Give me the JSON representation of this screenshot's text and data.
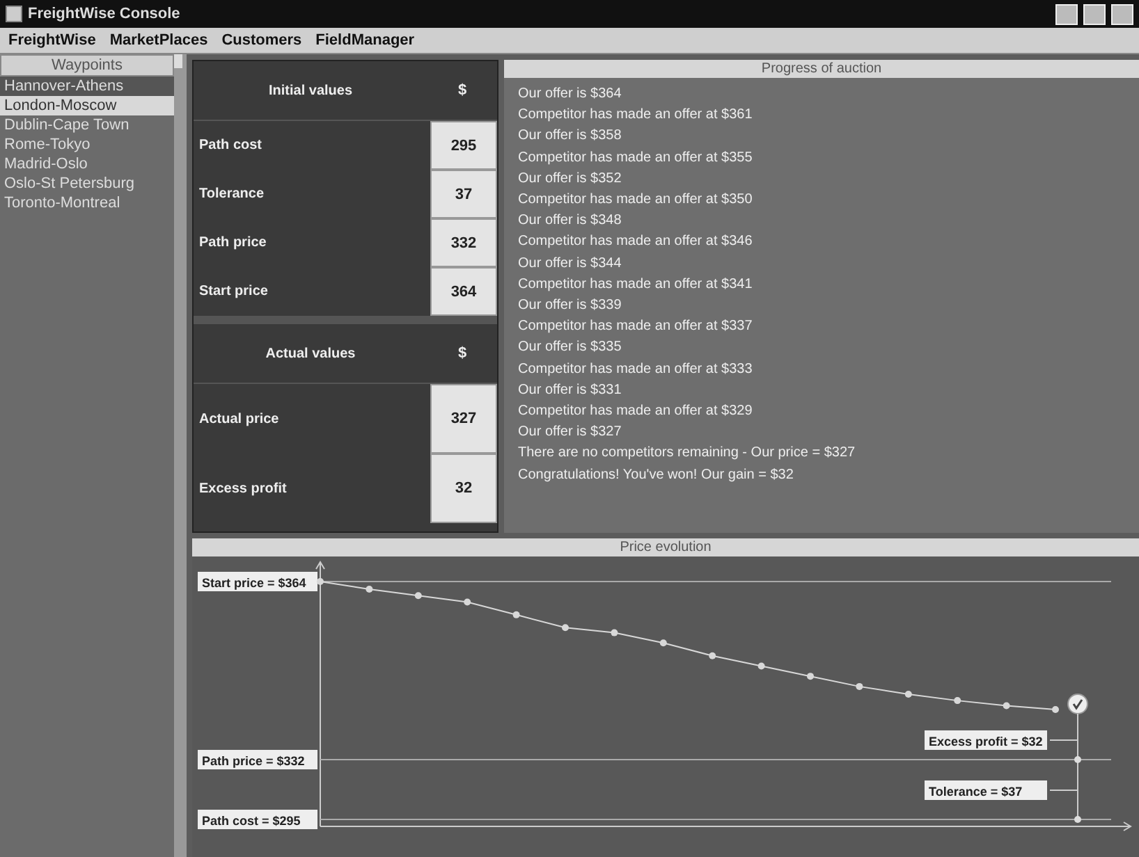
{
  "window": {
    "title": "FreightWise Console"
  },
  "menu": [
    "FreightWise",
    "MarketPlaces",
    "Customers",
    "FieldManager"
  ],
  "sidebar": {
    "header": "Waypoints",
    "items": [
      {
        "label": "Hannover-Athens",
        "selected": false
      },
      {
        "label": "London-Moscow",
        "selected": true
      },
      {
        "label": "Dublin-Cape Town",
        "selected": false
      },
      {
        "label": "Rome-Tokyo",
        "selected": false
      },
      {
        "label": "Madrid-Oslo",
        "selected": false
      },
      {
        "label": "Oslo-St Petersburg",
        "selected": false
      },
      {
        "label": "Toronto-Montreal",
        "selected": false
      }
    ]
  },
  "values_table": {
    "sections": [
      {
        "title": "Initial values",
        "unit": "$",
        "rows": [
          {
            "label": "Path cost",
            "value": "295"
          },
          {
            "label": "Tolerance",
            "value": "37"
          },
          {
            "label": "Path price",
            "value": "332"
          },
          {
            "label": "Start price",
            "value": "364"
          }
        ]
      },
      {
        "title": "Actual values",
        "unit": "$",
        "rows": [
          {
            "label": "Actual price",
            "value": "327"
          },
          {
            "label": "Excess profit",
            "value": "32"
          }
        ]
      }
    ]
  },
  "log": {
    "title": "Progress of auction",
    "lines": [
      "Our offer is $364",
      "Competitor has made an offer at $361",
      "Our offer is $358",
      "Competitor has made an offer at $355",
      "Our offer is $352",
      "Competitor has made an offer at $350",
      "Our offer is $348",
      "Competitor has made an offer at $346",
      "Our offer is $344",
      "Competitor has made an offer at $341",
      "Our offer is $339",
      "Competitor has made an offer at $337",
      "Our offer is $335",
      "Competitor has made an offer at $333",
      "Our offer is $331",
      "Competitor has made an offer at $329",
      "Our offer is $327",
      "There are no competitors remaining - Our price = $327",
      "Congratulations! You've won! Our gain = $32"
    ]
  },
  "chart": {
    "title": "Price evolution",
    "reference_labels": [
      "Start price = $364",
      "Path price = $332",
      "Path cost = $295"
    ],
    "annotation_labels": [
      "Excess profit = $32",
      "Tolerance = $37"
    ]
  }
}
